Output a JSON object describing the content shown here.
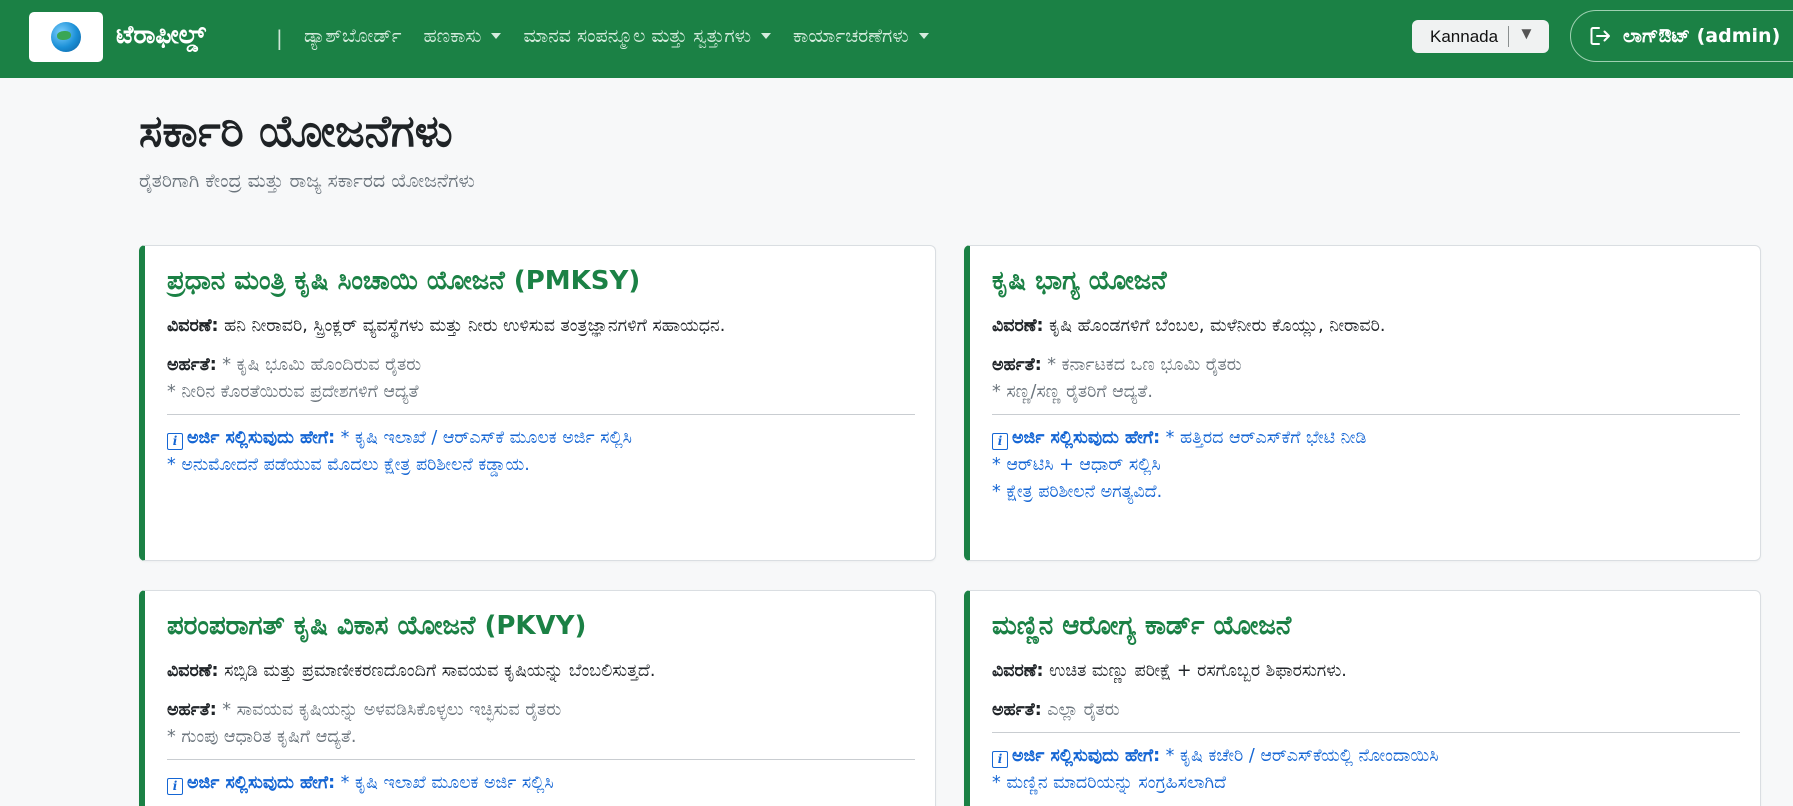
{
  "nav": {
    "brand": "ಟೆರಾಫೀಲ್ಡ್",
    "separator": "|",
    "items": [
      {
        "label": "ಡ್ಯಾಶ್‌ಬೋರ್ಡ್",
        "dropdown": false
      },
      {
        "label": "ಹಣಕಾಸು",
        "dropdown": true
      },
      {
        "label": "ಮಾನವ ಸಂಪನ್ಮೂಲ ಮತ್ತು ಸ್ವತ್ತುಗಳು",
        "dropdown": true
      },
      {
        "label": "ಕಾರ್ಯಾಚರಣೆಗಳು",
        "dropdown": true
      }
    ],
    "language": {
      "selected": "Kannada",
      "arrow": "▼"
    },
    "logout_label": "ಲಾಗ್‌ಔಟ್ (admin)"
  },
  "page": {
    "title": "ಸರ್ಕಾರಿ ಯೋಜನೆಗಳು",
    "subtitle": "ರೈತರಿಗಾಗಿ ಕೇಂದ್ರ ಮತ್ತು ರಾಜ್ಯ ಸರ್ಕಾರದ ಯೋಜನೆಗಳು"
  },
  "labels": {
    "description": "ವಿವರಣೆ:",
    "eligibility": "ಅರ್ಹತೆ:",
    "how_to_apply": "ಅರ್ಜಿ ಸಲ್ಲಿಸುವುದು ಹೇಗೆ:",
    "info_glyph": "i"
  },
  "schemes": [
    {
      "title": "ಪ್ರಧಾನ ಮಂತ್ರಿ ಕೃಷಿ ಸಿಂಚಾಯಿ ಯೋಜನೆ (PMKSY)",
      "description": "ಹನಿ ನೀರಾವರಿ, ಸ್ಪ್ರಿಂಕ್ಲರ್ ವ್ಯವಸ್ಥೆಗಳು ಮತ್ತು ನೀರು ಉಳಿಸುವ ತಂತ್ರಜ್ಞಾನಗಳಿಗೆ ಸಹಾಯಧನ.",
      "eligibility": [
        "* ಕೃಷಿ ಭೂಮಿ ಹೊಂದಿರುವ ರೈತರು",
        "* ನೀರಿನ ಕೊರತೆಯಿರುವ ಪ್ರದೇಶಗಳಿಗೆ ಆದ್ಯತೆ"
      ],
      "apply": [
        "* ಕೃಷಿ ಇಲಾಖೆ / ಆರ್‌ಎಸ್‌ಕೆ ಮೂಲಕ ಅರ್ಜಿ ಸಲ್ಲಿಸಿ",
        "* ಅನುಮೋದನೆ ಪಡೆಯುವ ಮೊದಲು ಕ್ಷೇತ್ರ ಪರಿಶೀಲನೆ ಕಡ್ಡಾಯ."
      ]
    },
    {
      "title": "ಕೃಷಿ ಭಾಗ್ಯ ಯೋಜನೆ",
      "description": "ಕೃಷಿ ಹೊಂಡಗಳಿಗೆ ಬೆಂಬಲ, ಮಳೆನೀರು ಕೊಯ್ಲು, ನೀರಾವರಿ.",
      "eligibility": [
        "* ಕರ್ನಾಟಕದ ಒಣ ಭೂಮಿ ರೈತರು",
        "* ಸಣ್ಣ/ಸಣ್ಣ ರೈತರಿಗೆ ಆದ್ಯತೆ."
      ],
      "apply": [
        "* ಹತ್ತಿರದ ಆರ್‌ಎಸ್‌ಕೆಗೆ ಭೇಟಿ ನೀಡಿ",
        "* ಆರ್‌ಟಿಸಿ + ಆಧಾರ್ ಸಲ್ಲಿಸಿ",
        "* ಕ್ಷೇತ್ರ ಪರಿಶೀಲನೆ ಅಗತ್ಯವಿದೆ."
      ]
    },
    {
      "title": "ಪರಂಪರಾಗತ್ ಕೃಷಿ ವಿಕಾಸ ಯೋಜನೆ (PKVY)",
      "description": "ಸಬ್ಸಿಡಿ ಮತ್ತು ಪ್ರಮಾಣೀಕರಣದೊಂದಿಗೆ ಸಾವಯವ ಕೃಷಿಯನ್ನು ಬೆಂಬಲಿಸುತ್ತದೆ.",
      "eligibility": [
        "* ಸಾವಯವ ಕೃಷಿಯನ್ನು ಅಳವಡಿಸಿಕೊಳ್ಳಲು ಇಚ್ಛಿಸುವ ರೈತರು",
        "* ಗುಂಪು ಆಧಾರಿತ ಕೃಷಿಗೆ ಆದ್ಯತೆ."
      ],
      "apply": [
        "* ಕೃಷಿ ಇಲಾಖೆ ಮೂಲಕ ಅರ್ಜಿ ಸಲ್ಲಿಸಿ"
      ]
    },
    {
      "title": "ಮಣ್ಣಿನ ಆರೋಗ್ಯ ಕಾರ್ಡ್ ಯೋಜನೆ",
      "description": "ಉಚಿತ ಮಣ್ಣು ಪರೀಕ್ಷೆ + ರಸಗೊಬ್ಬರ ಶಿಫಾರಸುಗಳು.",
      "eligibility": [
        "ಎಲ್ಲಾ ರೈತರು"
      ],
      "apply": [
        "* ಕೃಷಿ ಕಚೇರಿ / ಆರ್‌ಎಸ್‌ಕೆಯಲ್ಲಿ ನೋಂದಾಯಿಸಿ",
        "* ಮಣ್ಣಿನ ಮಾದರಿಯನ್ನು ಸಂಗ್ರಹಿಸಲಾಗಿದೆ"
      ]
    }
  ],
  "colors": {
    "navbar": "#1b8145",
    "accent": "#1b8145",
    "link": "#1566d4",
    "muted": "#6c757d"
  }
}
